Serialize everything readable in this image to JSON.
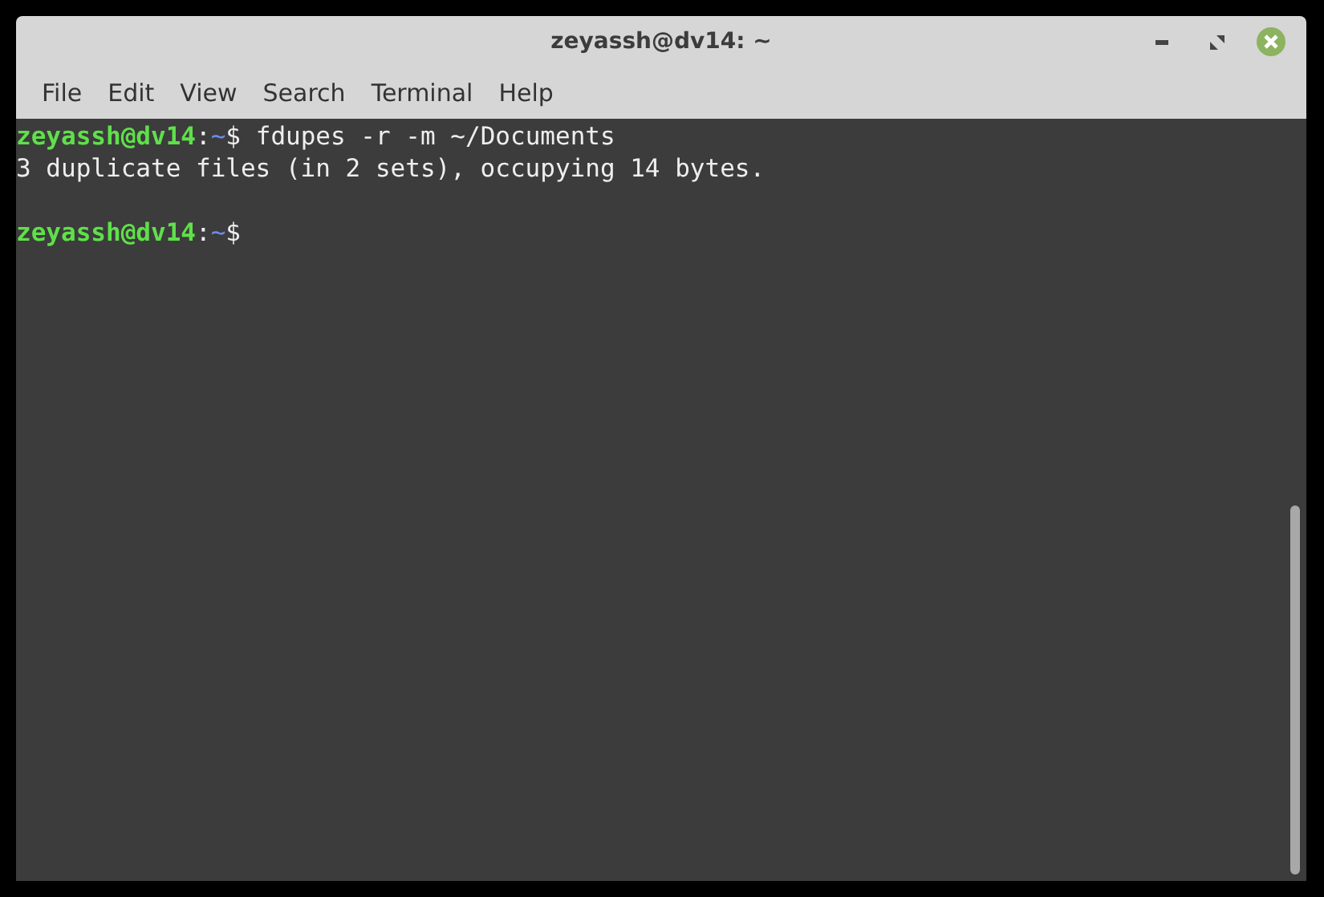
{
  "window": {
    "title": "zeyassh@dv14: ~"
  },
  "menu": [
    {
      "label": "File"
    },
    {
      "label": "Edit"
    },
    {
      "label": "View"
    },
    {
      "label": "Search"
    },
    {
      "label": "Terminal"
    },
    {
      "label": "Help"
    }
  ],
  "terminal": {
    "lines": [
      {
        "kind": "prompt",
        "user": "zeyassh@dv14",
        "separator": ":",
        "path": "~",
        "symbol": "$",
        "command": "fdupes -r -m ~/Documents"
      },
      {
        "kind": "output",
        "text": "3 duplicate files (in 2 sets), occupying 14 bytes."
      },
      {
        "kind": "blank"
      },
      {
        "kind": "prompt",
        "user": "zeyassh@dv14",
        "separator": ":",
        "path": "~",
        "symbol": "$"
      }
    ]
  }
}
